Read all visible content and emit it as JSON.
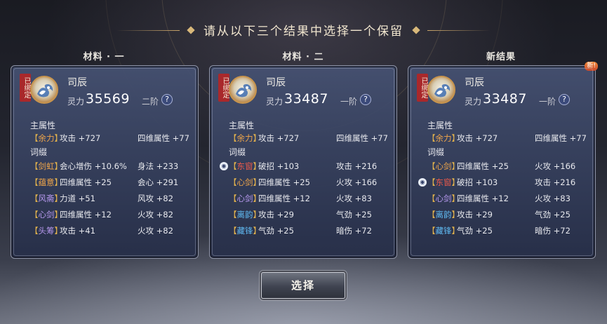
{
  "header": {
    "title": "请从以下三个结果中选择一个保留"
  },
  "colors": {
    "bracket": "#e0b14d",
    "purple_tag": "#b89af0",
    "orange_tag": "#f0a64a",
    "red_tag": "#ef5a4a",
    "blue_tag": "#5fb8f0",
    "bound_red": "#a9282b"
  },
  "columns": [
    {
      "label": "材料 · 一",
      "bound": "已绑定",
      "name": "司辰",
      "power_label": "灵力",
      "power": "35569",
      "rank": "二阶",
      "help": "?",
      "main_attr_title": "主属性",
      "main_attr": {
        "tag": "余力",
        "tag_color": "#f0a64a",
        "t1": "攻击 +727",
        "t2": "四维属性 +77"
      },
      "affix_title": "词缀",
      "affixes": [
        {
          "tag": "剑虹",
          "tag_color": "#f0a64a",
          "t1": "会心增伤 +10.6%",
          "t2": "身法 +233",
          "locked": false
        },
        {
          "tag": "蕴意",
          "tag_color": "#f0a64a",
          "t1": "四维属性 +25",
          "t2": "会心 +291",
          "locked": false
        },
        {
          "tag": "风斋",
          "tag_color": "#b89af0",
          "t1": "力道 +51",
          "t2": "风攻 +82",
          "locked": false
        },
        {
          "tag": "心剑",
          "tag_color": "#b89af0",
          "t1": "四维属性 +12",
          "t2": "火攻 +82",
          "locked": false
        },
        {
          "tag": "头筹",
          "tag_color": "#b89af0",
          "t1": "攻击 +41",
          "t2": "火攻 +82",
          "locked": false
        }
      ]
    },
    {
      "label": "材料 · 二",
      "bound": "已绑定",
      "name": "司辰",
      "power_label": "灵力",
      "power": "33487",
      "rank": "一阶",
      "help": "?",
      "main_attr_title": "主属性",
      "main_attr": {
        "tag": "余力",
        "tag_color": "#f0a64a",
        "t1": "攻击 +727",
        "t2": "四维属性 +77"
      },
      "affix_title": "词缀",
      "affixes": [
        {
          "tag": "东窗",
          "tag_color": "#ef5a4a",
          "t1": "破招 +103",
          "t2": "攻击 +216",
          "locked": true
        },
        {
          "tag": "心剑",
          "tag_color": "#f0a64a",
          "t1": "四维属性 +25",
          "t2": "火攻 +166",
          "locked": false
        },
        {
          "tag": "心剑",
          "tag_color": "#b89af0",
          "t1": "四维属性 +12",
          "t2": "火攻 +83",
          "locked": false
        },
        {
          "tag": "离韵",
          "tag_color": "#5fb8f0",
          "t1": "攻击 +29",
          "t2": "气劲 +25",
          "locked": false
        },
        {
          "tag": "藏锋",
          "tag_color": "#5fb8f0",
          "t1": "气劲 +25",
          "t2": "暗伤 +72",
          "locked": false
        }
      ]
    },
    {
      "label": "新结果",
      "new_badge": "新!",
      "bound": "已绑定",
      "name": "司辰",
      "power_label": "灵力",
      "power": "33487",
      "rank": "一阶",
      "help": "?",
      "main_attr_title": "主属性",
      "main_attr": {
        "tag": "余力",
        "tag_color": "#f0a64a",
        "t1": "攻击 +727",
        "t2": "四维属性 +77"
      },
      "affix_title": "词缀",
      "affixes": [
        {
          "tag": "心剑",
          "tag_color": "#f0a64a",
          "t1": "四维属性 +25",
          "t2": "火攻 +166",
          "locked": false
        },
        {
          "tag": "东窗",
          "tag_color": "#ef5a4a",
          "t1": "破招 +103",
          "t2": "攻击 +216",
          "locked": true
        },
        {
          "tag": "心剑",
          "tag_color": "#b89af0",
          "t1": "四维属性 +12",
          "t2": "火攻 +83",
          "locked": false
        },
        {
          "tag": "离韵",
          "tag_color": "#5fb8f0",
          "t1": "攻击 +29",
          "t2": "气劲 +25",
          "locked": false
        },
        {
          "tag": "藏锋",
          "tag_color": "#5fb8f0",
          "t1": "气劲 +25",
          "t2": "暗伤 +72",
          "locked": false
        }
      ]
    }
  ],
  "footer": {
    "select_label": "选择"
  }
}
